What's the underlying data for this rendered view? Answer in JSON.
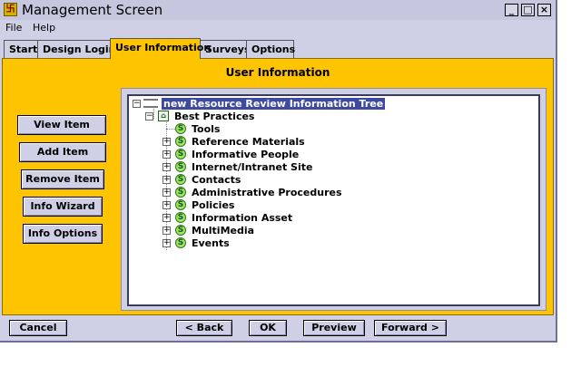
{
  "window": {
    "title": "Management Screen",
    "controls": {
      "minimize": "_",
      "maximize": "□",
      "close": "×"
    }
  },
  "menu": [
    "File",
    "Help"
  ],
  "tabs": [
    {
      "label": "Start",
      "active": false
    },
    {
      "label": "Design Login",
      "active": false
    },
    {
      "label": "User Information",
      "active": true
    },
    {
      "label": "Surveys",
      "active": false
    },
    {
      "label": "Options",
      "active": false
    }
  ],
  "panel": {
    "title": "User Information",
    "side_buttons": [
      "View Item",
      "Add Item",
      "Remove Item",
      "Info Wizard",
      "Info Options"
    ]
  },
  "tree": {
    "root": "new Resource Review Information Tree",
    "child": "Best Practices",
    "items": [
      "Tools",
      "Reference Materials",
      "Informative People",
      "Internet/Intranet Site",
      "Contacts",
      "Administrative Procedures",
      "Policies",
      "Information Asset",
      "MultiMedia",
      "Events"
    ],
    "icon_glyph": "S",
    "expand_glyph": "+",
    "collapse_glyph": "−"
  },
  "bottom_buttons": {
    "cancel": "Cancel",
    "back": "< Back",
    "ok": "OK",
    "preview": "Preview",
    "forward": "Forward >"
  },
  "colors": {
    "panel": "#ffc400",
    "window": "#cfcfe6",
    "selection": "#3d4aa0",
    "leaf_icon": "#9be36b"
  }
}
